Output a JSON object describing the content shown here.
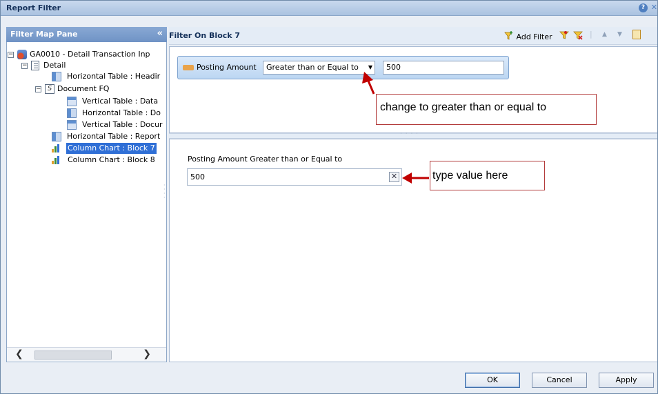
{
  "window": {
    "title": "Report Filter"
  },
  "left_pane": {
    "title": "Filter Map Pane",
    "collapse_glyph": "«",
    "tree": [
      {
        "label": "GA0010 - Detail Transaction Inp",
        "icon": "report-icon",
        "toggle": "−"
      },
      {
        "label": "Detail",
        "icon": "document-icon",
        "toggle": "−"
      },
      {
        "label": "Horizontal Table : Headir",
        "icon": "horizontal-table-icon"
      },
      {
        "label": "Document FQ",
        "icon": "section-icon",
        "toggle": "−"
      },
      {
        "label": "Vertical Table : Data",
        "icon": "vertical-table-icon"
      },
      {
        "label": "Horizontal Table : Do",
        "icon": "horizontal-table-icon"
      },
      {
        "label": "Vertical Table : Docur",
        "icon": "vertical-table-icon"
      },
      {
        "label": "Horizontal Table : Report",
        "icon": "horizontal-table-icon"
      },
      {
        "label": "Column Chart : Block 7",
        "icon": "column-chart-icon",
        "selected": true
      },
      {
        "label": "Column Chart : Block 8",
        "icon": "column-chart-icon"
      }
    ],
    "scroll_left": "❮",
    "scroll_right": "❯"
  },
  "right_pane": {
    "title": "Filter On Block 7",
    "toolbar": {
      "add_filter_label": "Add Filter"
    },
    "filter": {
      "object": "Posting Amount",
      "operator": "Greater than or Equal to",
      "value": "500"
    },
    "prompt": {
      "label": "Posting Amount Greater than or Equal to",
      "value": "500",
      "clear_glyph": "✕"
    }
  },
  "annotations": {
    "operator_note": "change to greater than or equal to",
    "value_note": "type value here",
    "arrow_color": "#c00000"
  },
  "buttons": {
    "ok": "OK",
    "cancel": "Cancel",
    "apply": "Apply"
  },
  "colors": {
    "accent": "#2f6fd6",
    "header": "#15315a"
  }
}
